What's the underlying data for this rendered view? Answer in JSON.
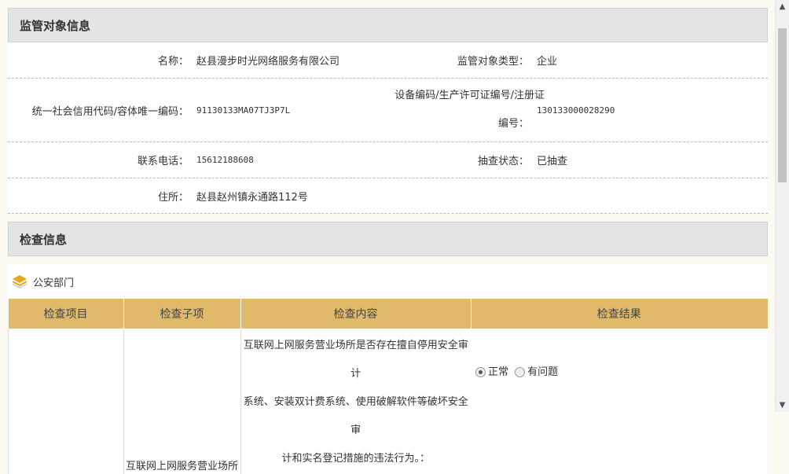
{
  "subject_section": {
    "title": "监管对象信息",
    "fields": {
      "name_label": "名称：",
      "name_value": "赵县漫步时光网络服务有限公司",
      "type_label": "监管对象类型：",
      "type_value": "企业",
      "credit_label": "统一社会信用代码/容体唯一编码：",
      "credit_value": "91130133MA07TJ3P7L",
      "device_label_line1": "设备编码/生产许可证编号/注册证",
      "device_label_line2": "编号：",
      "device_value": "130133000028290",
      "phone_label": "联系电话：",
      "phone_value": "15612188608",
      "status_label": "抽查状态：",
      "status_value": "已抽查",
      "address_label": "住所：",
      "address_value": "赵县赵州镇永通路112号"
    }
  },
  "inspection_section": {
    "title": "检查信息",
    "department": "公安部门",
    "columns": [
      "检查项目",
      "检查子项",
      "检查内容",
      "检查结果"
    ],
    "rows": [
      {
        "sub_item": "互联网上网服务营业场所",
        "content_lines": [
          "互联网上网服务营业场所是否存在擅自停用安全审计",
          "系统、安装双计费系统、使用破解软件等破坏安全审",
          "计和实名登记措施的违法行为。："
        ],
        "result_options": [
          "正常",
          "有问题"
        ],
        "result_selected": "正常"
      }
    ]
  },
  "icons": {
    "department_icon": "layers-icon",
    "scroll_up": "chevron-up-icon",
    "scroll_down": "chevron-down-icon"
  },
  "colors": {
    "table_header_bg": "#e0b96a",
    "section_header_bg": "#e4e4e4"
  }
}
